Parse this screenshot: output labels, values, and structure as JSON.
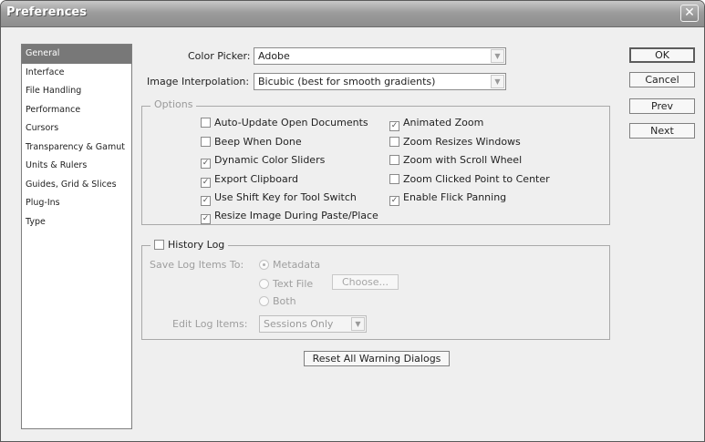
{
  "window": {
    "title": "Preferences",
    "close_glyph": "✕"
  },
  "sidebar": {
    "items": [
      {
        "label": "General",
        "selected": true
      },
      {
        "label": "Interface"
      },
      {
        "label": "File Handling"
      },
      {
        "label": "Performance"
      },
      {
        "label": "Cursors"
      },
      {
        "label": "Transparency & Gamut"
      },
      {
        "label": "Units & Rulers"
      },
      {
        "label": "Guides, Grid & Slices"
      },
      {
        "label": "Plug-Ins"
      },
      {
        "label": "Type"
      }
    ]
  },
  "general": {
    "color_picker_label": "Color Picker:",
    "color_picker_value": "Adobe",
    "interp_label": "Image Interpolation:",
    "interp_value": "Bicubic (best for smooth gradients)"
  },
  "options": {
    "legend": "Options",
    "items": [
      {
        "label": "Auto-Update Open Documents",
        "checked": false
      },
      {
        "label": "Animated Zoom",
        "checked": true
      },
      {
        "label": "Beep When Done",
        "checked": false
      },
      {
        "label": "Zoom Resizes Windows",
        "checked": false
      },
      {
        "label": "Dynamic Color Sliders",
        "checked": true
      },
      {
        "label": "Zoom with Scroll Wheel",
        "checked": false
      },
      {
        "label": "Export Clipboard",
        "checked": true
      },
      {
        "label": "Zoom Clicked Point to Center",
        "checked": false
      },
      {
        "label": "Use Shift Key for Tool Switch",
        "checked": true
      },
      {
        "label": "Enable Flick Panning",
        "checked": true
      },
      {
        "label": "Resize Image During Paste/Place",
        "checked": true
      }
    ]
  },
  "history": {
    "legend": "History Log",
    "checked": false,
    "save_label": "Save Log Items To:",
    "metadata": "Metadata",
    "text_file": "Text File",
    "both": "Both",
    "choose_button": "Choose...",
    "edit_label": "Edit Log Items:",
    "edit_value": "Sessions Only"
  },
  "reset_button": "Reset All Warning Dialogs",
  "buttons": {
    "ok": "OK",
    "cancel": "Cancel",
    "prev": "Prev",
    "next": "Next"
  }
}
